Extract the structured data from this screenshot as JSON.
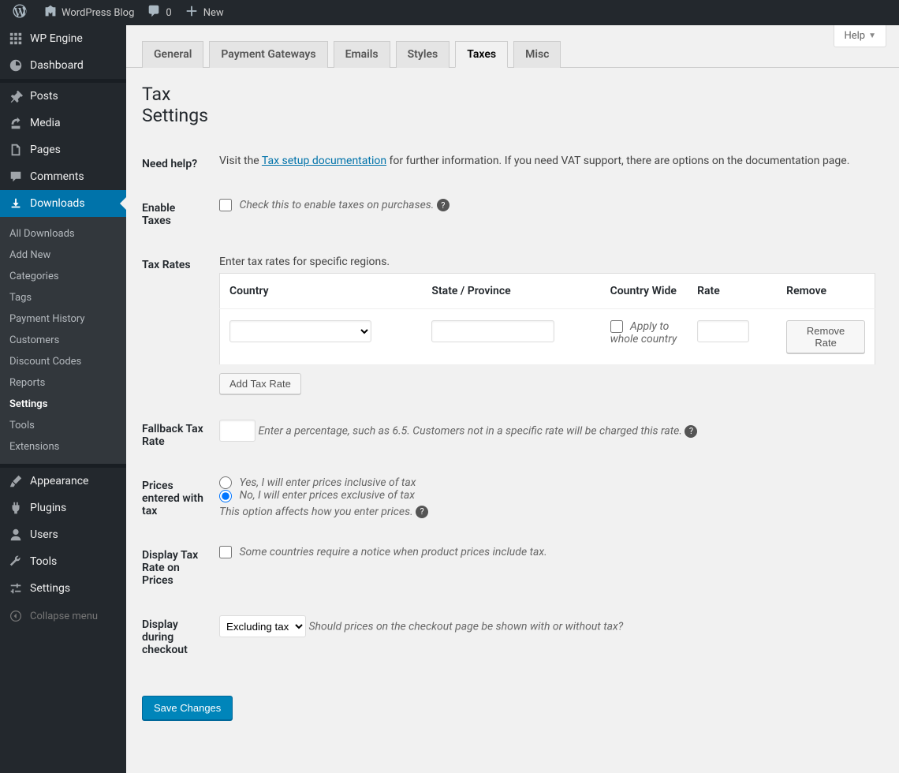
{
  "toolbar": {
    "site_name": "WordPress Blog",
    "comment_count": "0",
    "new_label": "New"
  },
  "help_label": "Help",
  "sidebar": {
    "items": [
      {
        "label": "WP Engine",
        "icon": "wpengine"
      },
      {
        "label": "Dashboard",
        "icon": "dashboard"
      }
    ],
    "items2": [
      {
        "label": "Posts",
        "icon": "pin"
      },
      {
        "label": "Media",
        "icon": "media"
      },
      {
        "label": "Pages",
        "icon": "page"
      },
      {
        "label": "Comments",
        "icon": "comment"
      }
    ],
    "current_label": "Downloads",
    "submenu": [
      "All Downloads",
      "Add New",
      "Categories",
      "Tags",
      "Payment History",
      "Customers",
      "Discount Codes",
      "Reports",
      "Settings",
      "Tools",
      "Extensions"
    ],
    "submenu_current_index": 8,
    "items3": [
      {
        "label": "Appearance",
        "icon": "brush"
      },
      {
        "label": "Plugins",
        "icon": "plugin"
      },
      {
        "label": "Users",
        "icon": "user"
      },
      {
        "label": "Tools",
        "icon": "wrench"
      },
      {
        "label": "Settings",
        "icon": "sliders"
      }
    ],
    "collapse_label": "Collapse menu"
  },
  "tabs": [
    "General",
    "Payment Gateways",
    "Emails",
    "Styles",
    "Taxes",
    "Misc"
  ],
  "active_tab_index": 4,
  "section_title": "Tax Settings",
  "need_help": {
    "label": "Need help?",
    "text_before": "Visit the ",
    "link": "Tax setup documentation",
    "text_after": " for further information. If you need VAT support, there are options on the documentation page."
  },
  "enable_taxes": {
    "label": "Enable Taxes",
    "desc": "Check this to enable taxes on purchases."
  },
  "tax_rates": {
    "label": "Tax Rates",
    "intro": "Enter tax rates for specific regions.",
    "headers": [
      "Country",
      "State / Province",
      "Country Wide",
      "Rate",
      "Remove"
    ],
    "apply_label": "Apply to whole country",
    "remove_btn": "Remove Rate",
    "add_btn": "Add Tax Rate"
  },
  "fallback": {
    "label": "Fallback Tax Rate",
    "desc": "Enter a percentage, such as 6.5. Customers not in a specific rate will be charged this rate."
  },
  "prices_entered": {
    "label": "Prices entered with tax",
    "opt1": "Yes, I will enter prices inclusive of tax",
    "opt2": "No, I will enter prices exclusive of tax",
    "desc": "This option affects how you enter prices."
  },
  "display_rate": {
    "label": "Display Tax Rate on Prices",
    "desc": "Some countries require a notice when product prices include tax."
  },
  "display_checkout": {
    "label": "Display during checkout",
    "selected": "Excluding tax",
    "desc": "Should prices on the checkout page be shown with or without tax?"
  },
  "save_label": "Save Changes"
}
